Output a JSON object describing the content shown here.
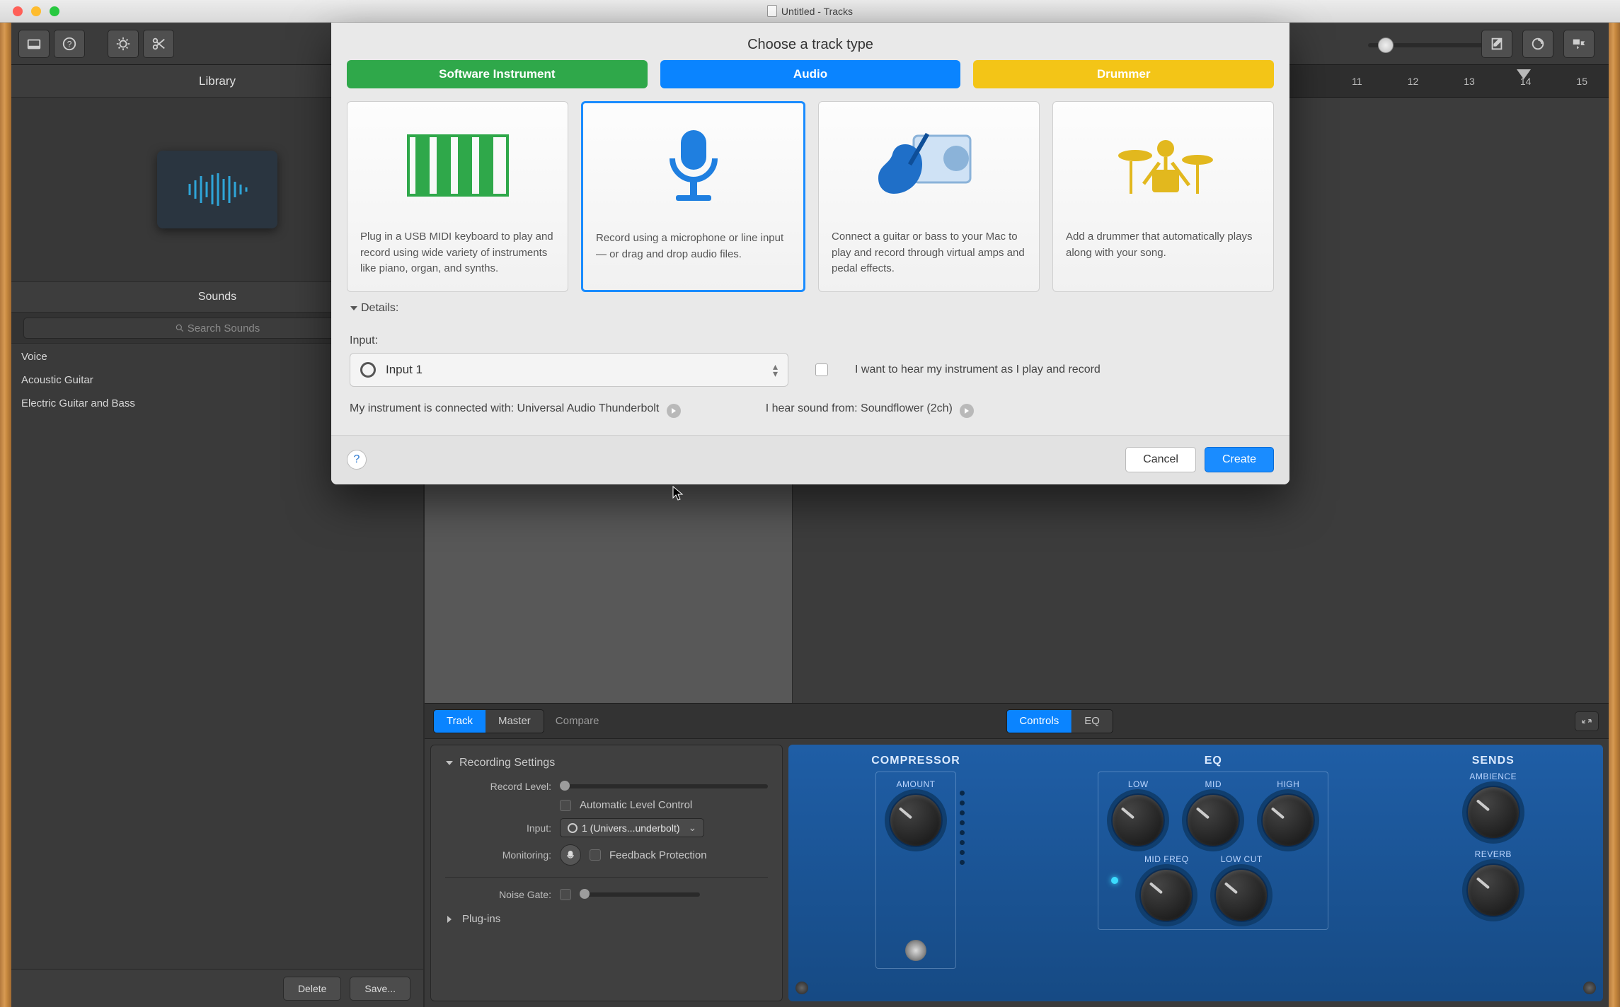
{
  "window": {
    "title": "Untitled - Tracks"
  },
  "toolbar": {
    "icons": [
      "library-drawer",
      "help",
      "view-options",
      "scissors"
    ],
    "right_icons": [
      "notepad",
      "loop",
      "media"
    ]
  },
  "library": {
    "header": "Library",
    "sounds_header": "Sounds",
    "search_placeholder": "Search Sounds",
    "items": [
      {
        "label": "Voice"
      },
      {
        "label": "Acoustic Guitar"
      },
      {
        "label": "Electric Guitar and Bass"
      }
    ],
    "footer": {
      "delete": "Delete",
      "save": "Save..."
    }
  },
  "timeline": {
    "visible_markers": [
      "11",
      "12",
      "13",
      "14",
      "15"
    ]
  },
  "smart_controls": {
    "tabs": {
      "track": "Track",
      "master": "Master"
    },
    "compare": "Compare",
    "view_tabs": {
      "controls": "Controls",
      "eq": "EQ"
    },
    "recording": {
      "title": "Recording Settings",
      "record_level_label": "Record Level:",
      "auto_level": "Automatic Level Control",
      "input_label": "Input:",
      "input_value": "1 (Univers...underbolt)",
      "monitoring_label": "Monitoring:",
      "feedback": "Feedback Protection",
      "noise_gate_label": "Noise Gate:",
      "plugins": "Plug-ins"
    },
    "panels": {
      "compressor": {
        "title": "COMPRESSOR",
        "knob": "AMOUNT"
      },
      "eq": {
        "title": "EQ",
        "knobs_top": [
          "LOW",
          "MID",
          "HIGH"
        ],
        "knobs_bottom": [
          "MID FREQ",
          "LOW CUT"
        ]
      },
      "sends": {
        "title": "SENDS",
        "knobs": [
          "AMBIENCE",
          "REVERB"
        ]
      }
    }
  },
  "modal": {
    "title": "Choose a track type",
    "tabs": {
      "software": "Software Instrument",
      "audio": "Audio",
      "drummer": "Drummer"
    },
    "cards": [
      {
        "desc": "Plug in a USB MIDI keyboard to play and record using wide variety of instruments like piano, organ, and synths."
      },
      {
        "desc": "Record using a microphone or line input — or drag and drop audio files."
      },
      {
        "desc": "Connect a guitar or bass to your Mac to play and record through virtual amps and pedal effects."
      },
      {
        "desc": "Add a drummer that automatically plays along with your song."
      }
    ],
    "details_label": "Details:",
    "input_label": "Input:",
    "input_value": "Input 1",
    "hear_checkbox": "I want to hear my instrument as I play and record",
    "connected_label": "My instrument is connected with: ",
    "connected_value": "Universal Audio Thunderbolt",
    "hear_from_label": "I hear sound from: ",
    "hear_from_value": "Soundflower (2ch)",
    "footer": {
      "cancel": "Cancel",
      "create": "Create"
    }
  }
}
